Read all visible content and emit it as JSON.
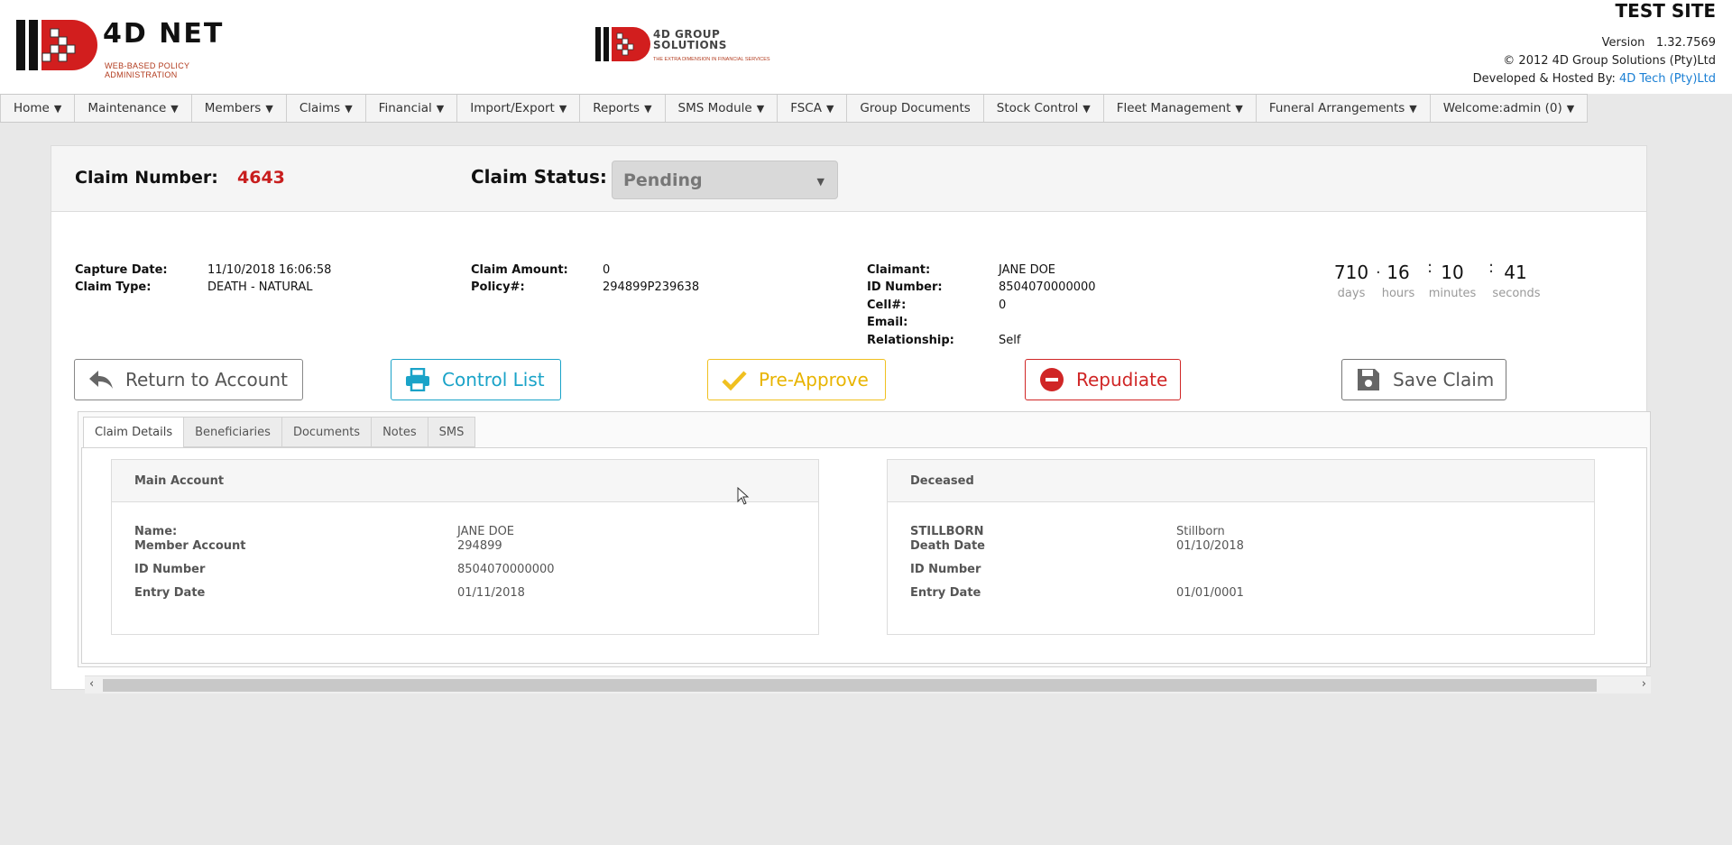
{
  "header": {
    "logo_title": "4D NET",
    "logo_subtitle": "WEB-BASED POLICY ADMINISTRATION",
    "group_logo_line1": "4D GROUP",
    "group_logo_line2": "SOLUTIONS",
    "group_logo_tagline": "THE EXTRA DIMENSION IN FINANCIAL SERVICES",
    "site_title": "TEST SITE",
    "version_label": "Version",
    "version_value": "1.32.7569",
    "copyright": "© 2012 4D Group Solutions (Pty)Ltd",
    "hosted_by_label": "Developed & Hosted By:",
    "hosted_by_link": "4D Tech (Pty)Ltd",
    "accent_color": "#c81e1e",
    "link_color": "#1a7fd4"
  },
  "nav": [
    {
      "label": "Home"
    },
    {
      "label": "Maintenance"
    },
    {
      "label": "Members"
    },
    {
      "label": "Claims"
    },
    {
      "label": "Financial"
    },
    {
      "label": "Import/Export"
    },
    {
      "label": "Reports"
    },
    {
      "label": "SMS Module"
    },
    {
      "label": "FSCA"
    },
    {
      "label": "Group Documents"
    },
    {
      "label": "Stock Control"
    },
    {
      "label": "Fleet Management"
    },
    {
      "label": "Funeral Arrangements"
    },
    {
      "label": "Welcome:admin (0)"
    }
  ],
  "claim": {
    "number_label": "Claim Number:",
    "number_value": "4643",
    "status_label": "Claim Status:",
    "status_value": "Pending",
    "capture_date_label": "Capture Date:",
    "capture_date_value": "11/10/2018 16:06:58",
    "claim_type_label": "Claim Type:",
    "claim_type_value": "DEATH - NATURAL",
    "amount_label": "Claim Amount:",
    "amount_value": "0",
    "policy_label": "Policy#:",
    "policy_value": "294899P239638",
    "claimant_label": "Claimant:",
    "claimant_value": "JANE DOE",
    "id_label": "ID Number:",
    "id_value": "8504070000000",
    "cell_label": "Cell#:",
    "cell_value": "0",
    "email_label": "Email:",
    "email_value": "",
    "relationship_label": "Relationship:",
    "relationship_value": "Self"
  },
  "timer": {
    "days": "710",
    "hours": "16",
    "minutes": "10",
    "seconds": "41",
    "days_label": "days",
    "hours_label": "hours",
    "minutes_label": "minutes",
    "seconds_label": "seconds"
  },
  "actions": {
    "return_label": "Return to Account",
    "control_label": "Control List",
    "preapprove_label": "Pre-Approve",
    "repudiate_label": "Repudiate",
    "save_label": "Save Claim",
    "return_icon": "reply-arrow-icon",
    "control_icon": "printer-icon",
    "preapprove_icon": "checkmark-icon",
    "repudiate_icon": "minus-circle-icon",
    "save_icon": "floppy-disk-icon"
  },
  "tabs": [
    {
      "label": "Claim Details",
      "active": true
    },
    {
      "label": "Beneficiaries"
    },
    {
      "label": "Documents"
    },
    {
      "label": "Notes"
    },
    {
      "label": "SMS"
    }
  ],
  "main_account": {
    "title": "Main Account",
    "name_label": "Name:",
    "name_value": "JANE DOE",
    "member_label": "Member Account",
    "member_value": "294899",
    "id_label": "ID Number",
    "id_value": "8504070000000",
    "entry_label": "Entry Date",
    "entry_value": "01/11/2018"
  },
  "deceased": {
    "title": "Deceased",
    "stillborn_label": "STILLBORN",
    "stillborn_value": "Stillborn",
    "death_label": "Death Date",
    "death_value": "01/10/2018",
    "id_label": "ID Number",
    "id_value": "",
    "entry_label": "Entry Date",
    "entry_value": "01/01/0001"
  }
}
